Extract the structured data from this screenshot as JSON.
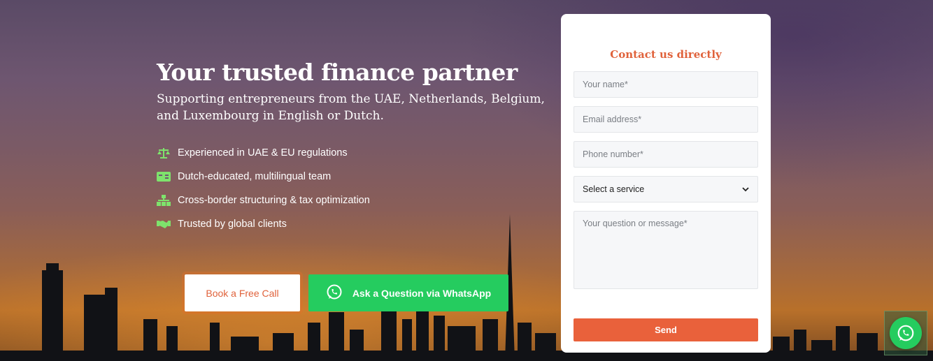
{
  "hero": {
    "title": "Your trusted finance partner",
    "subtitle": "Supporting entrepreneurs from the UAE, Netherlands, Belgium, and Luxembourg in English or Dutch.",
    "features": [
      {
        "icon": "scales-icon",
        "label": "Experienced in UAE & EU regulations"
      },
      {
        "icon": "translate-icon",
        "label": "Dutch-educated, multilingual team"
      },
      {
        "icon": "sitemap-icon",
        "label": "Cross-border structuring & tax optimization"
      },
      {
        "icon": "handshake-icon",
        "label": "Trusted by global clients"
      }
    ]
  },
  "cta": {
    "book_label": "Book a Free Call",
    "whatsapp_label": "Ask a Question via WhatsApp"
  },
  "form": {
    "title": "Contact us directly",
    "name_placeholder": "Your name*",
    "email_placeholder": "Email address*",
    "phone_placeholder": "Phone number*",
    "service_selected": "Select a service",
    "message_placeholder": "Your question or message*",
    "send_label": "Send"
  },
  "colors": {
    "accent": "#e0623b",
    "whatsapp_green": "#25cc5f",
    "feature_icon_green": "#7ee36c"
  },
  "floating_button": {
    "icon": "whatsapp-icon"
  }
}
